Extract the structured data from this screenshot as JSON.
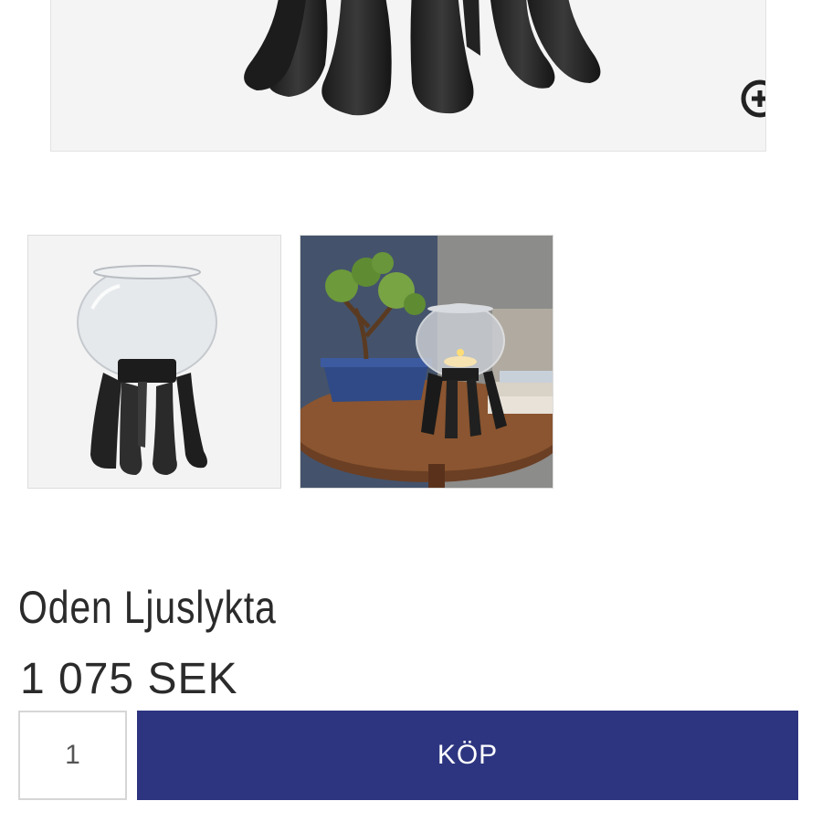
{
  "gallery": {
    "main_image_alt": "",
    "zoom_icon": "zoom-in-icon",
    "thumbnails": [
      {
        "icon": "product-thumbnail"
      },
      {
        "icon": "lifestyle-thumbnail"
      }
    ]
  },
  "product": {
    "title": "Oden Ljuslykta",
    "price": "1 075 SEK"
  },
  "purchase": {
    "quantity": "1",
    "buy_label": "KÖP"
  },
  "colors": {
    "buy_button": "#2d3580",
    "text": "#2b2b2b"
  }
}
